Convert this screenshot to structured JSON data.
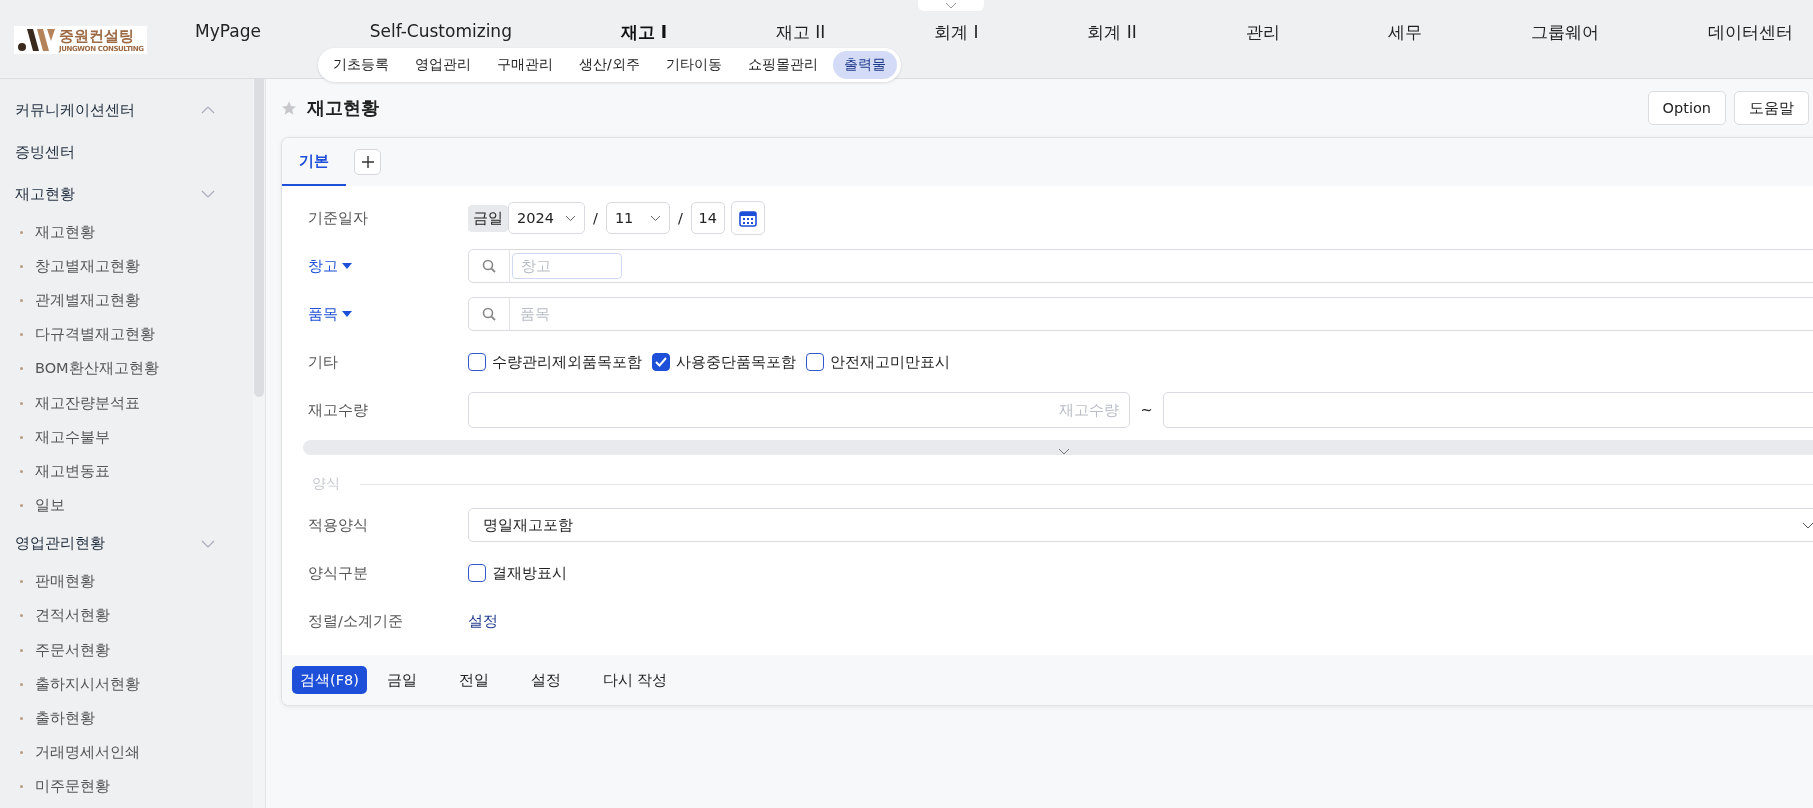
{
  "logo": {
    "name": "중원컨설팅",
    "subtitle": "JUNGWON CONSULTING"
  },
  "top_nav": [
    {
      "label": "MyPage",
      "selected": false
    },
    {
      "label": "Self-Customizing",
      "selected": false
    },
    {
      "label": "재고 I",
      "selected": true
    },
    {
      "label": "재고 II",
      "selected": false
    },
    {
      "label": "회계 I",
      "selected": false
    },
    {
      "label": "회계 II",
      "selected": false
    },
    {
      "label": "관리",
      "selected": false
    },
    {
      "label": "세무",
      "selected": false
    },
    {
      "label": "그룹웨어",
      "selected": false
    },
    {
      "label": "데이터센터",
      "selected": false
    }
  ],
  "sub_nav": [
    {
      "label": "기초등록",
      "selected": false
    },
    {
      "label": "영업관리",
      "selected": false
    },
    {
      "label": "구매관리",
      "selected": false
    },
    {
      "label": "생산/외주",
      "selected": false
    },
    {
      "label": "기타이동",
      "selected": false
    },
    {
      "label": "쇼핑몰관리",
      "selected": false
    },
    {
      "label": "출력물",
      "selected": true
    }
  ],
  "sidebar": {
    "items": [
      {
        "label": "커뮤니케이션센터",
        "kind": "group",
        "expanded": false
      },
      {
        "label": "증빙센터",
        "kind": "link"
      },
      {
        "label": "재고현황",
        "kind": "group",
        "expanded": true,
        "children": [
          {
            "label": "재고현황"
          },
          {
            "label": "창고별재고현황"
          },
          {
            "label": "관계별재고현황"
          },
          {
            "label": "다규격별재고현황"
          },
          {
            "label": "BOM환산재고현황"
          },
          {
            "label": "재고잔량분석표"
          },
          {
            "label": "재고수불부"
          },
          {
            "label": "재고변동표"
          },
          {
            "label": "일보"
          }
        ]
      },
      {
        "label": "영업관리현황",
        "kind": "group",
        "expanded": true,
        "children": [
          {
            "label": "판매현황"
          },
          {
            "label": "견적서현황"
          },
          {
            "label": "주문서현황"
          },
          {
            "label": "출하지시서현황"
          },
          {
            "label": "출하현황"
          },
          {
            "label": "거래명세서인쇄"
          },
          {
            "label": "미주문현황"
          }
        ]
      }
    ]
  },
  "page": {
    "title": "재고현황",
    "favorite": false,
    "buttons": [
      "Option",
      "도움말"
    ]
  },
  "tabs": [
    {
      "label": "기본",
      "selected": true
    }
  ],
  "form": {
    "date": {
      "label": "기준일자",
      "today": "금일",
      "year": "2024",
      "month": "11",
      "day": "14",
      "separator": "/"
    },
    "warehouse": {
      "label": "창고",
      "placeholder": "창고"
    },
    "item": {
      "label": "품목",
      "placeholder": "품목"
    },
    "other": {
      "label": "기타",
      "options": [
        {
          "label": "수량관리제외품목포함",
          "checked": false
        },
        {
          "label": "사용중단품목포함",
          "checked": true
        },
        {
          "label": "안전재고미만표시",
          "checked": false
        }
      ]
    },
    "quantity": {
      "label": "재고수량",
      "placeholder": "재고수량",
      "separator": "~"
    },
    "section": "양식",
    "template": {
      "label": "적용양식",
      "value": "명일재고포함"
    },
    "template_type": {
      "label": "양식구분",
      "options": [
        {
          "label": "결재방표시",
          "checked": false
        }
      ]
    },
    "sort": {
      "label": "정렬/소계기준",
      "link": "설정"
    }
  },
  "actions": [
    {
      "label": "검색(F8)",
      "primary": true
    },
    {
      "label": "금일",
      "primary": false
    },
    {
      "label": "전일",
      "primary": false
    },
    {
      "label": "설정",
      "primary": false
    },
    {
      "label": "다시 작성",
      "primary": false
    }
  ]
}
